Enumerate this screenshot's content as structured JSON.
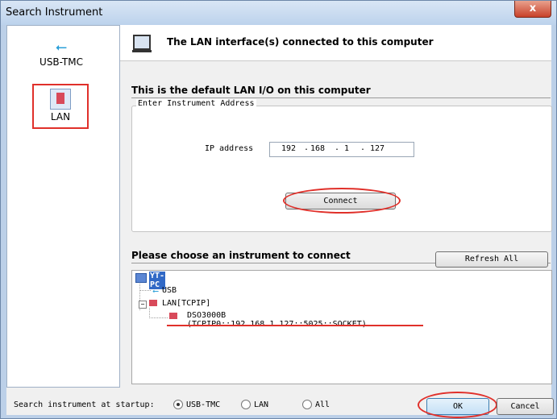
{
  "window": {
    "title": "Search Instrument",
    "close_label": "x"
  },
  "sidebar": {
    "items": [
      {
        "label": "USB-TMC"
      },
      {
        "label": "LAN"
      }
    ]
  },
  "header": {
    "text": "The LAN interface(s) connected to this computer"
  },
  "section_default": {
    "title": "This is the default LAN I/O on this computer"
  },
  "address_group": {
    "legend": "Enter Instrument Address",
    "ip_label": "IP address",
    "ip_octets": [
      "192",
      "168",
      "1",
      "127"
    ],
    "connect_label": "Connect"
  },
  "instruments": {
    "title": "Please choose an instrument to connect",
    "refresh_label": "Refresh All",
    "tree": {
      "root": "YT-PC",
      "usb": "USB",
      "lan": "LAN[TCPIP]",
      "instrument": "DSO3000B  (TCPIP0::192.168.1.127::5025::SOCKET)"
    }
  },
  "footer": {
    "startup_label": "Search instrument at startup:",
    "options": [
      "USB-TMC",
      "LAN",
      "All"
    ],
    "selected": "USB-TMC",
    "ok_label": "OK",
    "cancel_label": "Cancel"
  }
}
